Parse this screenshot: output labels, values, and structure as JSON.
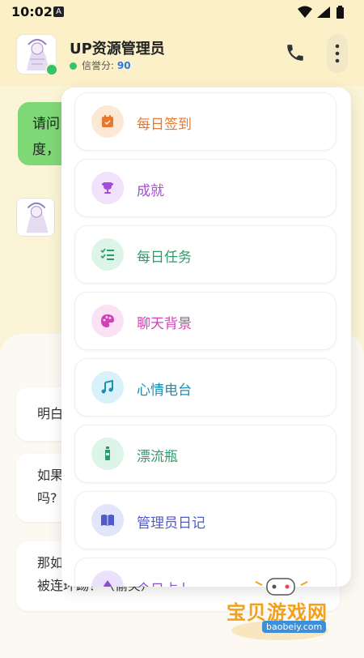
{
  "status": {
    "time": "10:02",
    "notif_badge": "A"
  },
  "header": {
    "title": "UP资源管理员",
    "reputation_label": "信誉分:",
    "reputation_value": "90"
  },
  "chat": {
    "user_bubble_line1": "请问",
    "user_bubble_line2": "度，",
    "suggestions": [
      {
        "line1": "明白",
        "line2": ""
      },
      {
        "line1": "如果",
        "line2": "吗?"
      },
      {
        "line1": "那如",
        "line2": "被连环踢？（偷笑）"
      }
    ]
  },
  "menu": {
    "items": [
      {
        "label": "每日签到",
        "icon": "calendar-check-icon",
        "color": "#e8772f",
        "bg": "#fde8d6"
      },
      {
        "label": "成就",
        "icon": "trophy-icon",
        "color": "#a64bd8",
        "bg": "#f1e1fb"
      },
      {
        "label": "每日任务",
        "icon": "checklist-icon",
        "color": "#2f9a6c",
        "bg": "#dcf5e8"
      },
      {
        "label": "聊天背景",
        "icon": "palette-icon",
        "color": "#d43fb8",
        "bg": "#fbe1f4"
      },
      {
        "label": "心情电台",
        "icon": "music-note-icon",
        "color": "#1e8fb4",
        "bg": "#d9f2f9"
      },
      {
        "label": "漂流瓶",
        "icon": "bottle-icon",
        "color": "#2c9a6b",
        "bg": "#dcf5e8"
      },
      {
        "label": "管理员日记",
        "icon": "book-icon",
        "color": "#4f5bc9",
        "bg": "#e3e6fb"
      },
      {
        "label": "今日占卜",
        "icon": "crystal-icon",
        "color": "#8a4fd0",
        "bg": "#ece1fb"
      }
    ]
  },
  "watermark": {
    "text": "宝贝游戏网",
    "url": "baobeiy.com"
  }
}
